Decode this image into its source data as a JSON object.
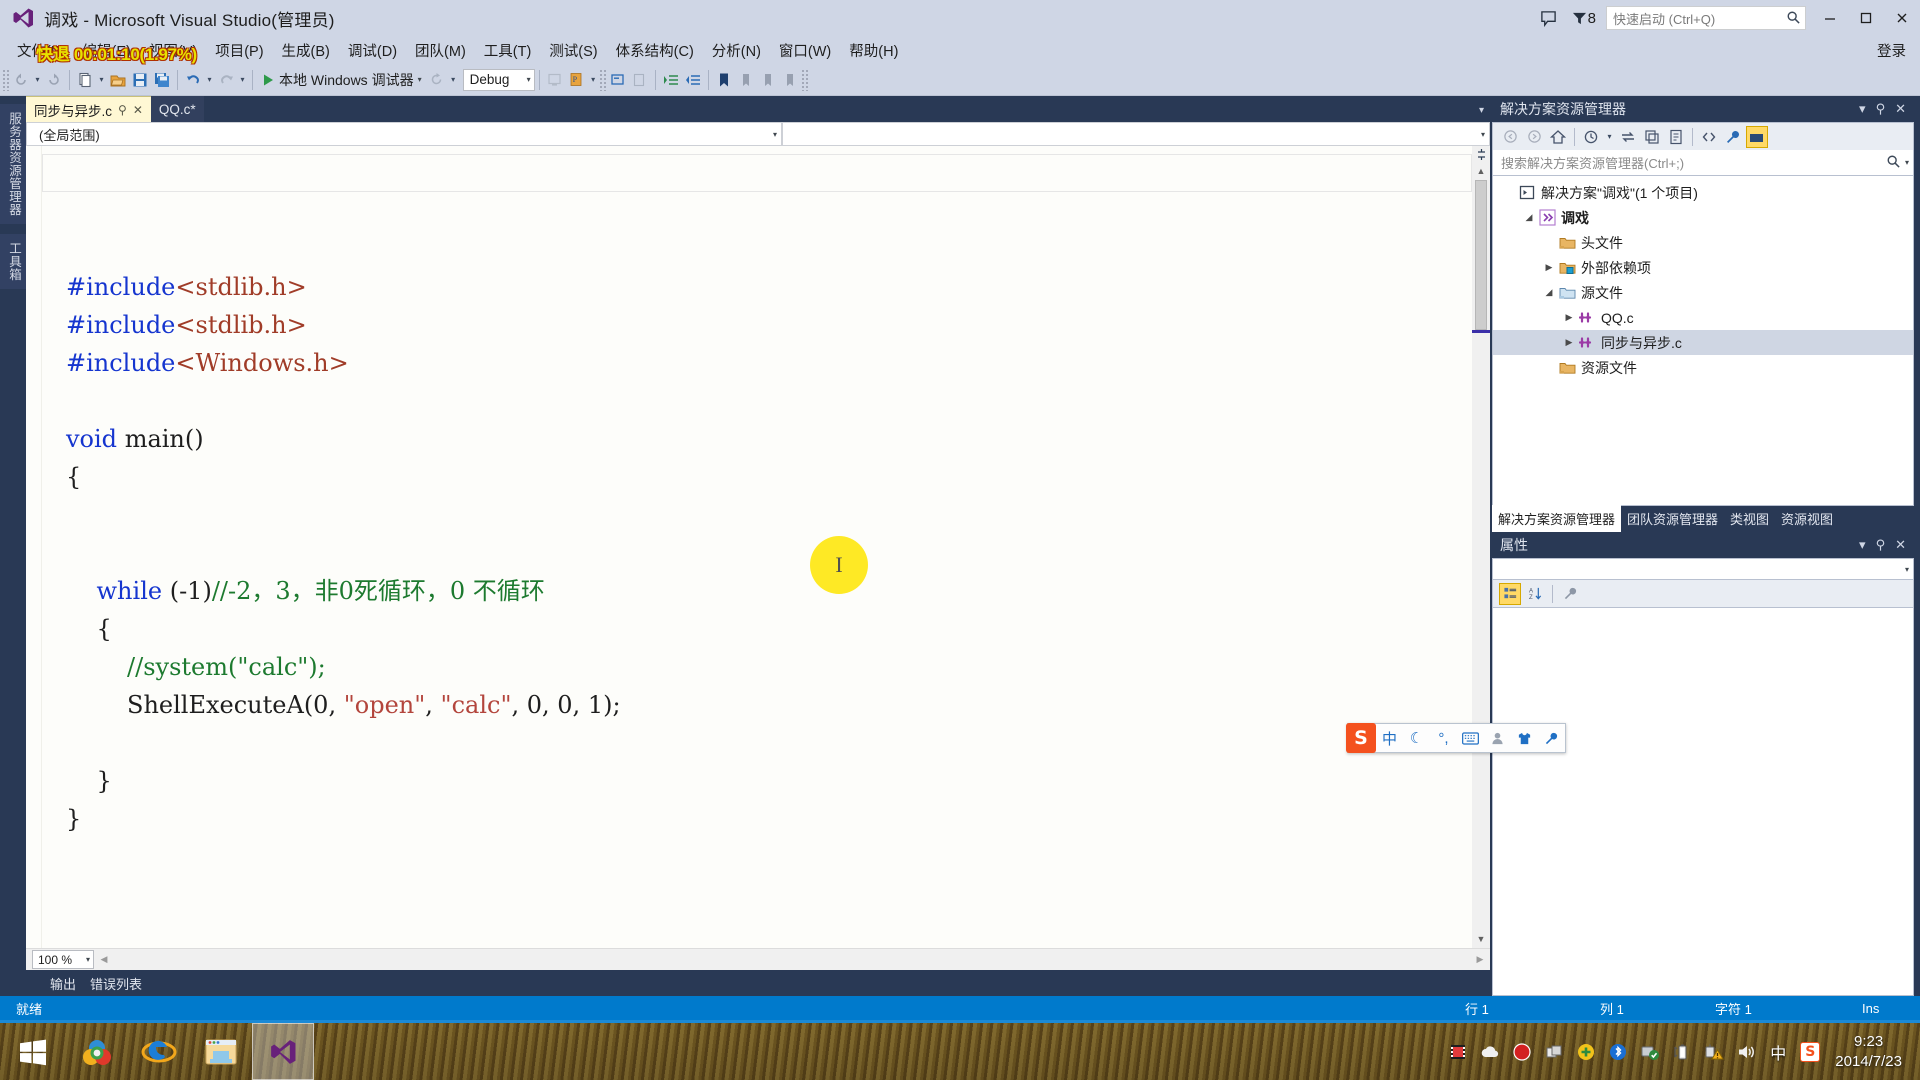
{
  "window": {
    "title": "调戏 - Microsoft Visual Studio(管理员)",
    "notification_count": "8",
    "minimize": "–",
    "maximize": "❐",
    "close": "✕"
  },
  "quick_launch": {
    "placeholder": "快速启动 (Ctrl+Q)",
    "icon": "search-icon"
  },
  "menu": {
    "items": [
      "文件(F)",
      "编辑(E)",
      "视图(V)",
      "项目(P)",
      "生成(B)",
      "调试(D)",
      "团队(M)",
      "工具(T)",
      "测试(S)",
      "体系结构(C)",
      "分析(N)",
      "窗口(W)",
      "帮助(H)"
    ],
    "login": "登录"
  },
  "toolbar": {
    "run_label": "本地 Windows 调试器",
    "config": "Debug"
  },
  "overlay": {
    "rec_text": "快退 00:01:10(1.97%)"
  },
  "left_dock": {
    "tabs": [
      "服务器资源管理器",
      "工具箱"
    ]
  },
  "editor": {
    "tabs": [
      {
        "label": "同步与异步.c",
        "active": true,
        "pin": "⚲",
        "close": "✕"
      },
      {
        "label": "QQ.c*",
        "active": false
      }
    ],
    "nav_scope": "(全局范围)",
    "nav_member": "",
    "zoom": "100 %",
    "code_lines": [
      {
        "segs": [
          {
            "t": "#include",
            "c": "pp"
          },
          {
            "t": "<stdlib.h>",
            "c": "hdr"
          }
        ]
      },
      {
        "segs": [
          {
            "t": "#include",
            "c": "pp"
          },
          {
            "t": "<stdlib.h>",
            "c": "hdr"
          }
        ]
      },
      {
        "segs": [
          {
            "t": "#include",
            "c": "pp"
          },
          {
            "t": "<Windows.h>",
            "c": "hdr"
          }
        ]
      },
      {
        "segs": []
      },
      {
        "segs": [
          {
            "t": "void ",
            "c": "kw"
          },
          {
            "t": "main()",
            "c": ""
          }
        ]
      },
      {
        "segs": [
          {
            "t": "{",
            "c": ""
          }
        ]
      },
      {
        "segs": []
      },
      {
        "segs": []
      },
      {
        "segs": [
          {
            "t": "    ",
            "c": ""
          },
          {
            "t": "while",
            "c": "kw"
          },
          {
            "t": " (-1)",
            "c": ""
          },
          {
            "t": "//-2，3，非0死循环，0 不循环",
            "c": "cmt"
          }
        ]
      },
      {
        "segs": [
          {
            "t": "    {",
            "c": ""
          }
        ]
      },
      {
        "segs": [
          {
            "t": "        ",
            "c": ""
          },
          {
            "t": "//system(\"calc\");",
            "c": "cmt"
          }
        ]
      },
      {
        "segs": [
          {
            "t": "        ShellExecuteA(0, ",
            "c": ""
          },
          {
            "t": "\"open\"",
            "c": "str"
          },
          {
            "t": ", ",
            "c": ""
          },
          {
            "t": "\"calc\"",
            "c": "str"
          },
          {
            "t": ", 0, 0, 1);",
            "c": ""
          }
        ]
      },
      {
        "segs": []
      },
      {
        "segs": [
          {
            "t": "    }",
            "c": ""
          }
        ]
      },
      {
        "segs": [
          {
            "t": "}",
            "c": ""
          }
        ]
      }
    ]
  },
  "bottom_docks": [
    "输出",
    "错误列表"
  ],
  "solution_explorer": {
    "title": "解决方案资源管理器",
    "header_actions": [
      "▾",
      "⚲",
      "✕"
    ],
    "toolbar_icons": [
      "back-icon",
      "forward-icon",
      "home-icon",
      "pending-changes-icon",
      "sync-icon",
      "collapse-all-icon",
      "properties-page-icon",
      "show-all-files-icon",
      "wrench-icon",
      "view-designer-icon"
    ],
    "search_placeholder": "搜索解决方案资源管理器(Ctrl+;)",
    "tree": [
      {
        "label": "解决方案\"调戏\"(1 个项目)",
        "indent": 0,
        "twisty": "",
        "icon": "solution-icon",
        "bold": false,
        "selected": false
      },
      {
        "label": "调戏",
        "indent": 1,
        "twisty": "▴",
        "icon": "project-icon",
        "bold": true,
        "selected": false
      },
      {
        "label": "头文件",
        "indent": 2,
        "twisty": "",
        "icon": "folder-icon",
        "bold": false,
        "selected": false
      },
      {
        "label": "外部依赖项",
        "indent": 2,
        "twisty": "▸",
        "icon": "folder-ext-icon",
        "bold": false,
        "selected": false
      },
      {
        "label": "源文件",
        "indent": 2,
        "twisty": "▴",
        "icon": "folder-open-icon",
        "bold": false,
        "selected": false
      },
      {
        "label": "QQ.c",
        "indent": 3,
        "twisty": "▸",
        "icon": "c-file-icon",
        "bold": false,
        "selected": false
      },
      {
        "label": "同步与异步.c",
        "indent": 3,
        "twisty": "▸",
        "icon": "c-file-icon",
        "bold": false,
        "selected": true
      },
      {
        "label": "资源文件",
        "indent": 2,
        "twisty": "",
        "icon": "folder-icon",
        "bold": false,
        "selected": false
      }
    ],
    "tabs": [
      {
        "label": "解决方案资源管理器",
        "active": true
      },
      {
        "label": "团队资源管理器",
        "active": false
      },
      {
        "label": "类视图",
        "active": false
      },
      {
        "label": "资源视图",
        "active": false
      }
    ]
  },
  "properties": {
    "title": "属性",
    "header_actions": [
      "▾",
      "⚲",
      "✕"
    ],
    "toolbar_icons": [
      "categorized-icon",
      "alphabetical-icon",
      "property-pages-icon"
    ]
  },
  "status_bar": {
    "state": "就绪",
    "row": "行 1",
    "col": "列 1",
    "char": "字符 1",
    "insert": "Ins"
  },
  "ime": {
    "logo": "S",
    "buttons": [
      "中",
      "☾",
      "°,",
      "⌨",
      "👤",
      "👕",
      "🔧"
    ]
  },
  "taskbar": {
    "start": "start-icon",
    "apps": [
      "chrome-icon",
      "internet-explorer-icon",
      "file-explorer-icon",
      "visual-studio-icon"
    ],
    "tray": [
      "media-icon",
      "cloud-icon",
      "record-stop-icon",
      "windows-copy-icon",
      "antivirus-icon",
      "bluetooth-icon",
      "safe-eject-icon",
      "battery-icon",
      "network-warning-icon",
      "volume-icon",
      "ime-cn-icon",
      "sogou-icon"
    ],
    "clock_time": "9:23",
    "clock_date": "2014/7/23"
  }
}
